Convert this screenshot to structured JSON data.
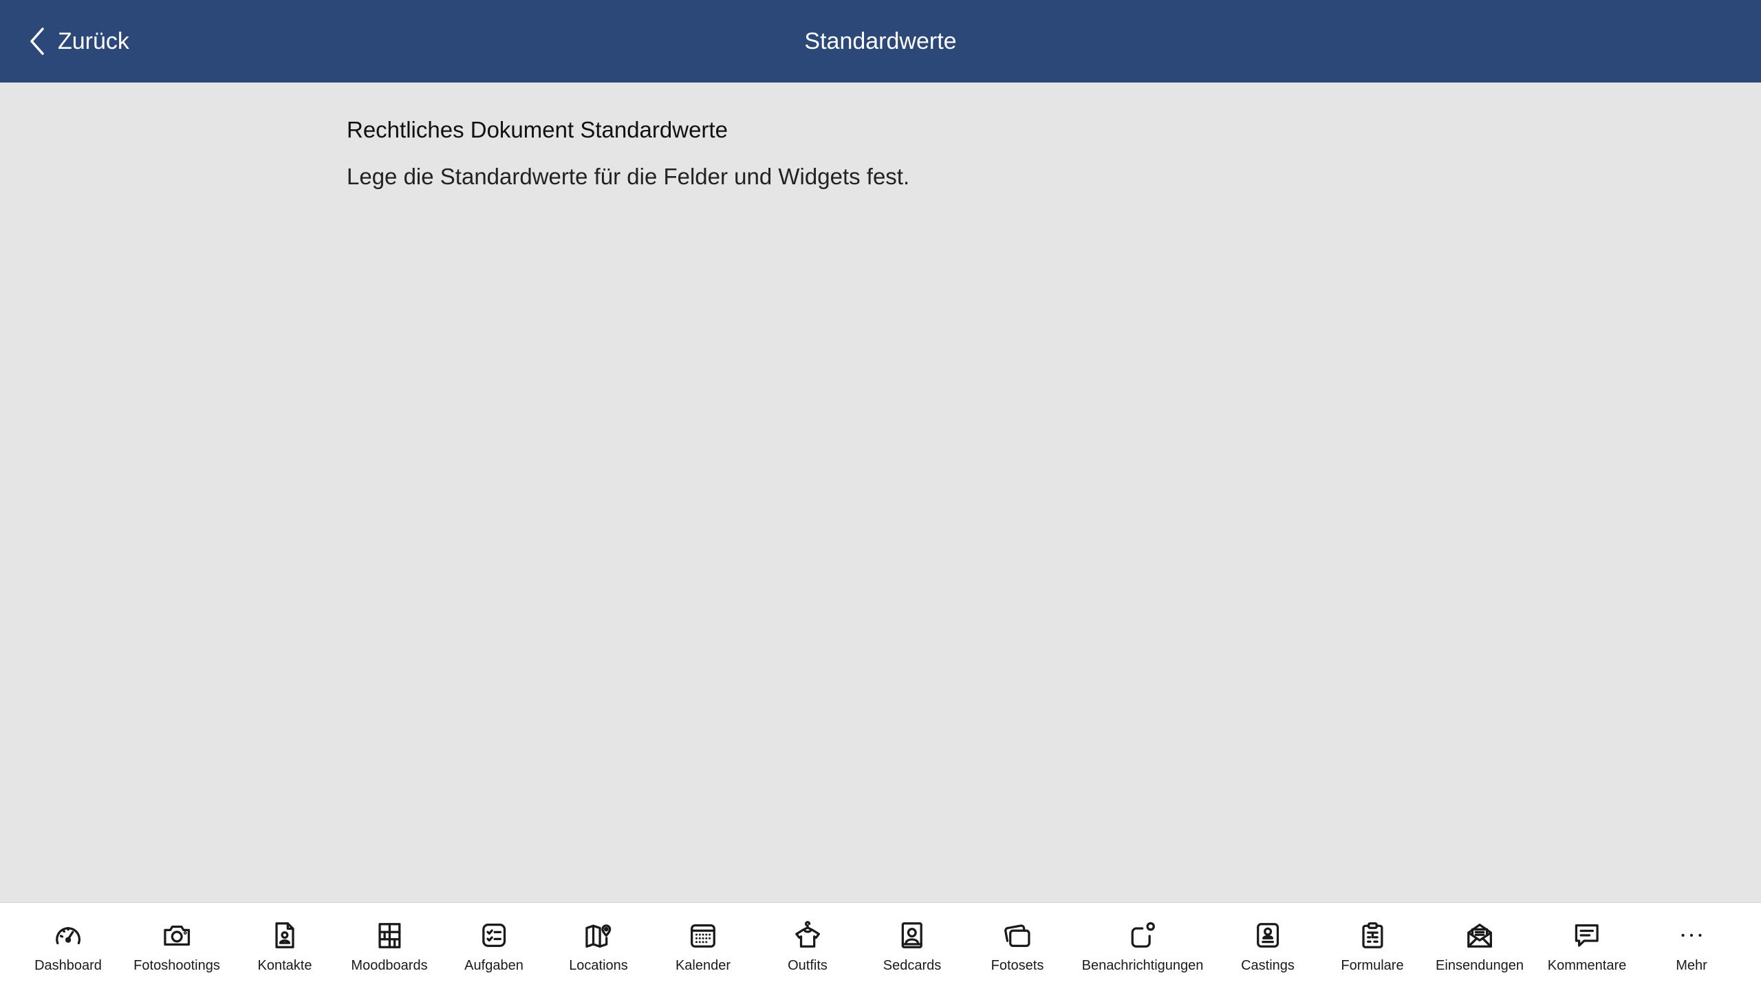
{
  "navbar": {
    "back_label": "Zurück",
    "title": "Standardwerte",
    "background": "#2c4878"
  },
  "content": {
    "title": "Rechtliches Dokument Standardwerte",
    "description": "Lege die Standardwerte für die Felder und Widgets fest."
  },
  "tabbar": {
    "items": [
      {
        "label": "Dashboard",
        "icon": "dashboard-gauge-icon"
      },
      {
        "label": "Fotoshootings",
        "icon": "camera-icon"
      },
      {
        "label": "Kontakte",
        "icon": "contact-file-icon"
      },
      {
        "label": "Moodboards",
        "icon": "moodboard-grid-icon"
      },
      {
        "label": "Aufgaben",
        "icon": "checklist-icon"
      },
      {
        "label": "Locations",
        "icon": "map-pin-icon"
      },
      {
        "label": "Kalender",
        "icon": "calendar-icon"
      },
      {
        "label": "Outfits",
        "icon": "hanger-shirt-icon"
      },
      {
        "label": "Sedcards",
        "icon": "portrait-card-icon"
      },
      {
        "label": "Fotosets",
        "icon": "photo-stack-icon"
      },
      {
        "label": "Benachrichtigungen",
        "icon": "notification-icon"
      },
      {
        "label": "Castings",
        "icon": "badge-person-icon"
      },
      {
        "label": "Formulare",
        "icon": "clipboard-form-icon"
      },
      {
        "label": "Einsendungen",
        "icon": "envelope-open-icon"
      },
      {
        "label": "Kommentare",
        "icon": "comment-icon"
      },
      {
        "label": "Mehr",
        "icon": "more-dots-icon"
      }
    ]
  }
}
